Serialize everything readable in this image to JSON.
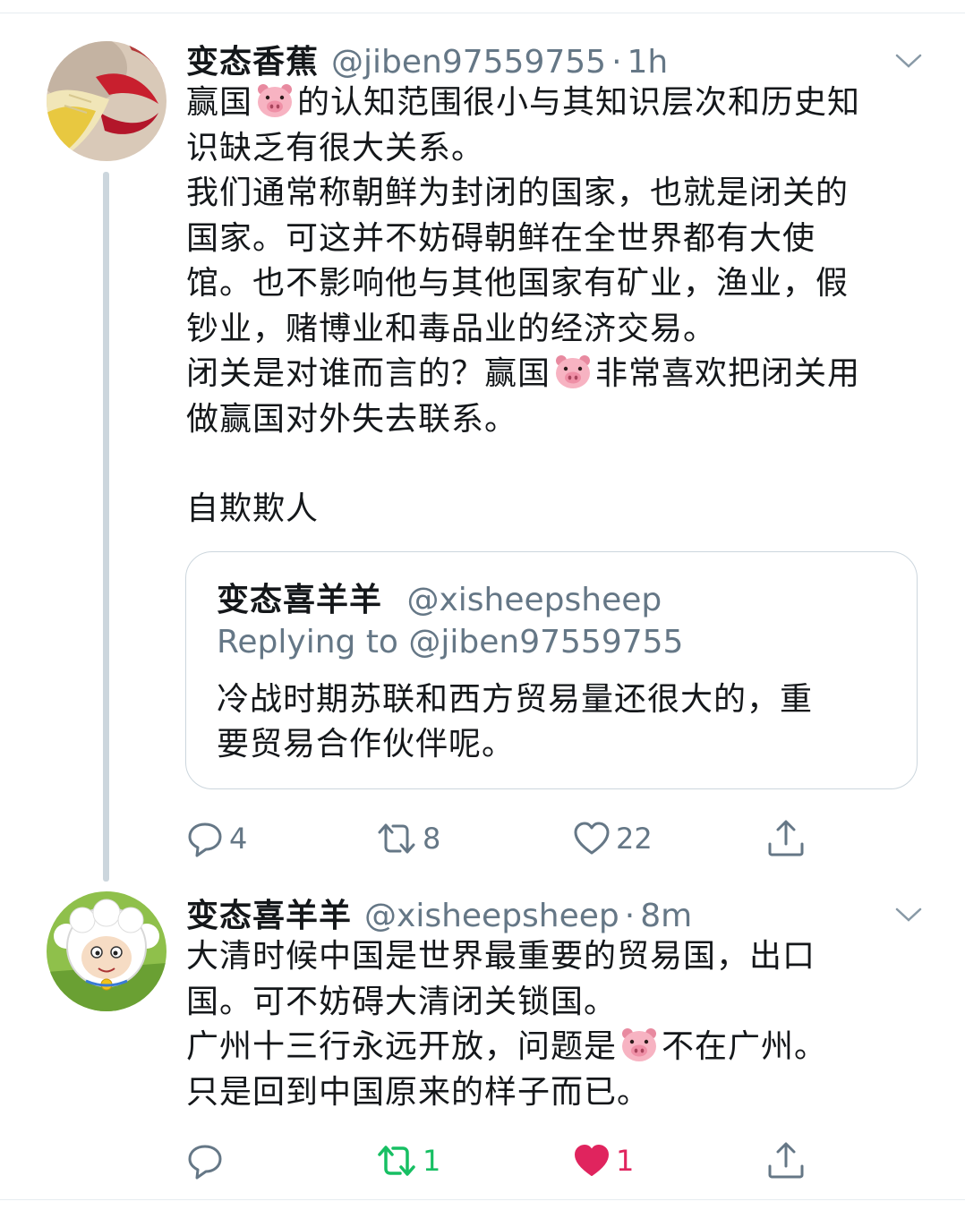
{
  "tweets": [
    {
      "name": "变态香蕉",
      "handle": "@jiben97559755",
      "dot": "·",
      "time": "1h",
      "lines": [
        [
          "赢国",
          "pig",
          "的认知范围很小与其知识层次和历史知"
        ],
        [
          "识缺乏有很大关系。"
        ],
        [
          "我们通常称朝鲜为封闭的国家，也就是闭关的"
        ],
        [
          "国家。可这并不妨碍朝鲜在全世界都有大使"
        ],
        [
          "馆。也不影响他与其他国家有矿业，渔业，假"
        ],
        [
          "钞业，赌博业和毒品业的经济交易。"
        ],
        [
          "闭关是对谁而言的？赢国",
          "pig",
          "非常喜欢把闭关用"
        ],
        [
          "做赢国对外失去联系。"
        ],
        [],
        [
          "自欺欺人"
        ]
      ],
      "quote": {
        "name": "变态喜羊羊",
        "handle": "@xisheepsheep",
        "replying": "Replying to @jiben97559755",
        "line1": "冷战时期苏联和西方贸易量还很大的，重",
        "line2": "要贸易合作伙伴呢。"
      },
      "actions": {
        "replies": "4",
        "retweets": "8",
        "likes": "22"
      }
    },
    {
      "name": "变态喜羊羊",
      "handle": "@xisheepsheep",
      "dot": "·",
      "time": "8m",
      "lines": [
        [
          "大清时候中国是世界最重要的贸易国，出口"
        ],
        [
          "国。可不妨碍大清闭关锁国。"
        ],
        [
          "广州十三行永远开放，问题是",
          "pig",
          "不在广州。"
        ],
        [
          "只是回到中国原来的样子而已。"
        ]
      ],
      "actions": {
        "replies": "",
        "retweets": "1",
        "likes": "1"
      }
    }
  ],
  "icons": {
    "reply": "reply-icon",
    "retweet": "retweet-icon",
    "like": "heart-icon",
    "share": "share-icon",
    "caret": "chevron-down-icon",
    "emoji": "pig-face-emoji"
  },
  "colors": {
    "text": "#14171a",
    "secondary": "#657786",
    "border": "#ccd6dd",
    "retweet_active": "#17bf63",
    "like_active": "#e0245e"
  }
}
